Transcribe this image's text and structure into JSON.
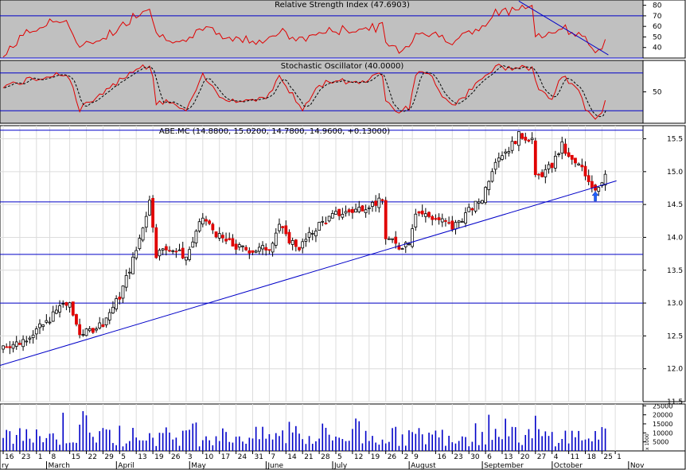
{
  "colors": {
    "indicator_bg": "#c0c0c0",
    "price_bg": "#ffffff",
    "grid": "#dcdcdc",
    "level_line": "#0000c8",
    "indicator_line": "#e00000",
    "up_candle": "#ffffff",
    "down_candle": "#e00000",
    "candle_outline": "#000000",
    "volume_bar": "#0000c8",
    "arrow": "#2060ff"
  },
  "chart_data": {
    "type": "candlestick",
    "panels": {
      "rsi": {
        "title": "Relative Strength Index (47.6903)",
        "ylim": [
          30,
          85
        ],
        "y_ticks": [
          40,
          50,
          60,
          70,
          80
        ],
        "levels": [
          30,
          70
        ],
        "trendline": {
          "from": {
            "date": "Sep 16",
            "value": 84
          },
          "to": {
            "date": "Oct 21",
            "value": 33
          }
        }
      },
      "stochastic": {
        "title": "Stochastic Oscillator (40.0000)",
        "ylim": [
          0,
          100
        ],
        "y_ticks": [
          50
        ],
        "levels": [
          20,
          80
        ]
      },
      "price": {
        "title": "ABE.MC (14.8800, 15.0200, 14.7800, 14.9600, +0.13000)",
        "ylim": [
          11.5,
          15.7
        ],
        "y_ticks": [
          11.5,
          12.0,
          12.5,
          13.0,
          13.5,
          14.0,
          14.5,
          15.0,
          15.5
        ],
        "horizontal_levels": [
          15.63,
          14.54,
          13.74,
          13.0
        ],
        "trendline": {
          "from": {
            "date": "Feb 10",
            "value": 12.05
          },
          "to": {
            "date": "Oct 22",
            "value": 14.86
          }
        },
        "marker": {
          "type": "up-arrow",
          "date": "Oct 17",
          "value": 14.6
        }
      },
      "volume": {
        "ylim": [
          0,
          26000
        ],
        "y_ticks": [
          5000,
          10000,
          15000,
          20000,
          25000
        ],
        "y_tick_labels": [
          "5000",
          "10000",
          "15000",
          "20000",
          "25000"
        ],
        "unit_label": "x 1000"
      }
    },
    "x_axis": {
      "days": [
        "16",
        "23",
        "1",
        "8",
        "15",
        "22",
        "29",
        "5",
        "13",
        "19",
        "26",
        "3",
        "10",
        "17",
        "24",
        "31",
        "7",
        "14",
        "21",
        "28",
        "5",
        "12",
        "19",
        "26",
        "2",
        "9",
        "16",
        "23",
        "30",
        "6",
        "13",
        "20",
        "27",
        "4",
        "11",
        "18",
        "25",
        "1"
      ],
      "months": [
        "ry",
        "March",
        "April",
        "May",
        "June",
        "July",
        "August",
        "September",
        "October",
        "Nov"
      ]
    },
    "anchors": [
      [
        "Feb 10",
        12.35,
        30,
        60
      ],
      [
        "Feb 17",
        12.4,
        50,
        65
      ],
      [
        "Feb 28",
        12.7,
        62,
        75
      ],
      [
        "Mar 7",
        13.0,
        68,
        80
      ],
      [
        "Mar 11",
        12.95,
        60,
        70
      ],
      [
        "Mar 14",
        12.55,
        38,
        22
      ],
      [
        "Mar 18",
        12.55,
        42,
        30
      ],
      [
        "Mar 25",
        12.7,
        50,
        45
      ],
      [
        "Apr 1",
        13.1,
        58,
        70
      ],
      [
        "Apr 8",
        13.8,
        72,
        88
      ],
      [
        "Apr 12",
        14.55,
        80,
        92
      ],
      [
        "Apr 14",
        14.2,
        65,
        75
      ],
      [
        "Apr 16",
        13.75,
        52,
        30
      ],
      [
        "Apr 22",
        13.85,
        50,
        35
      ],
      [
        "Apr 29",
        13.7,
        42,
        18
      ],
      [
        "May 6",
        14.3,
        60,
        75
      ],
      [
        "May 13",
        14.0,
        52,
        45
      ],
      [
        "May 20",
        13.85,
        48,
        35
      ],
      [
        "May 27",
        13.8,
        47,
        38
      ],
      [
        "Jun 3",
        13.85,
        48,
        45
      ],
      [
        "Jun 6",
        14.2,
        56,
        75
      ],
      [
        "Jun 10",
        14.0,
        52,
        60
      ],
      [
        "Jun 14",
        13.85,
        46,
        28
      ],
      [
        "Jun 17",
        13.9,
        48,
        22
      ],
      [
        "Jun 24",
        14.2,
        54,
        60
      ],
      [
        "Jul 1",
        14.35,
        56,
        70
      ],
      [
        "Jul 8",
        14.4,
        57,
        65
      ],
      [
        "Jul 15",
        14.5,
        58,
        70
      ],
      [
        "Jul 19",
        14.55,
        60,
        80
      ],
      [
        "Jul 22",
        14.0,
        44,
        40
      ],
      [
        "Jul 26",
        13.85,
        38,
        18
      ],
      [
        "Jul 31",
        13.95,
        42,
        25
      ],
      [
        "Aug 2",
        14.4,
        55,
        80
      ],
      [
        "Aug 9",
        14.3,
        52,
        75
      ],
      [
        "Aug 14",
        14.25,
        50,
        45
      ],
      [
        "Aug 19",
        14.15,
        47,
        30
      ],
      [
        "Aug 23",
        14.35,
        52,
        45
      ],
      [
        "Aug 30",
        14.6,
        58,
        70
      ],
      [
        "Sep 5",
        15.2,
        72,
        90
      ],
      [
        "Sep 11",
        15.35,
        75,
        88
      ],
      [
        "Sep 16",
        15.55,
        80,
        92
      ],
      [
        "Sep 20",
        15.5,
        78,
        88
      ],
      [
        "Sep 23",
        14.9,
        52,
        65
      ],
      [
        "Sep 26",
        15.0,
        50,
        45
      ],
      [
        "Sep 30",
        15.1,
        52,
        40
      ],
      [
        "Oct 3",
        15.4,
        62,
        75
      ],
      [
        "Oct 7",
        15.2,
        55,
        65
      ],
      [
        "Oct 11",
        15.05,
        50,
        45
      ],
      [
        "Oct 14",
        14.9,
        46,
        25
      ],
      [
        "Oct 17",
        14.75,
        38,
        10
      ],
      [
        "Oct 21",
        14.85,
        42,
        15
      ],
      [
        "Oct 22",
        14.96,
        47.69,
        40
      ]
    ]
  }
}
